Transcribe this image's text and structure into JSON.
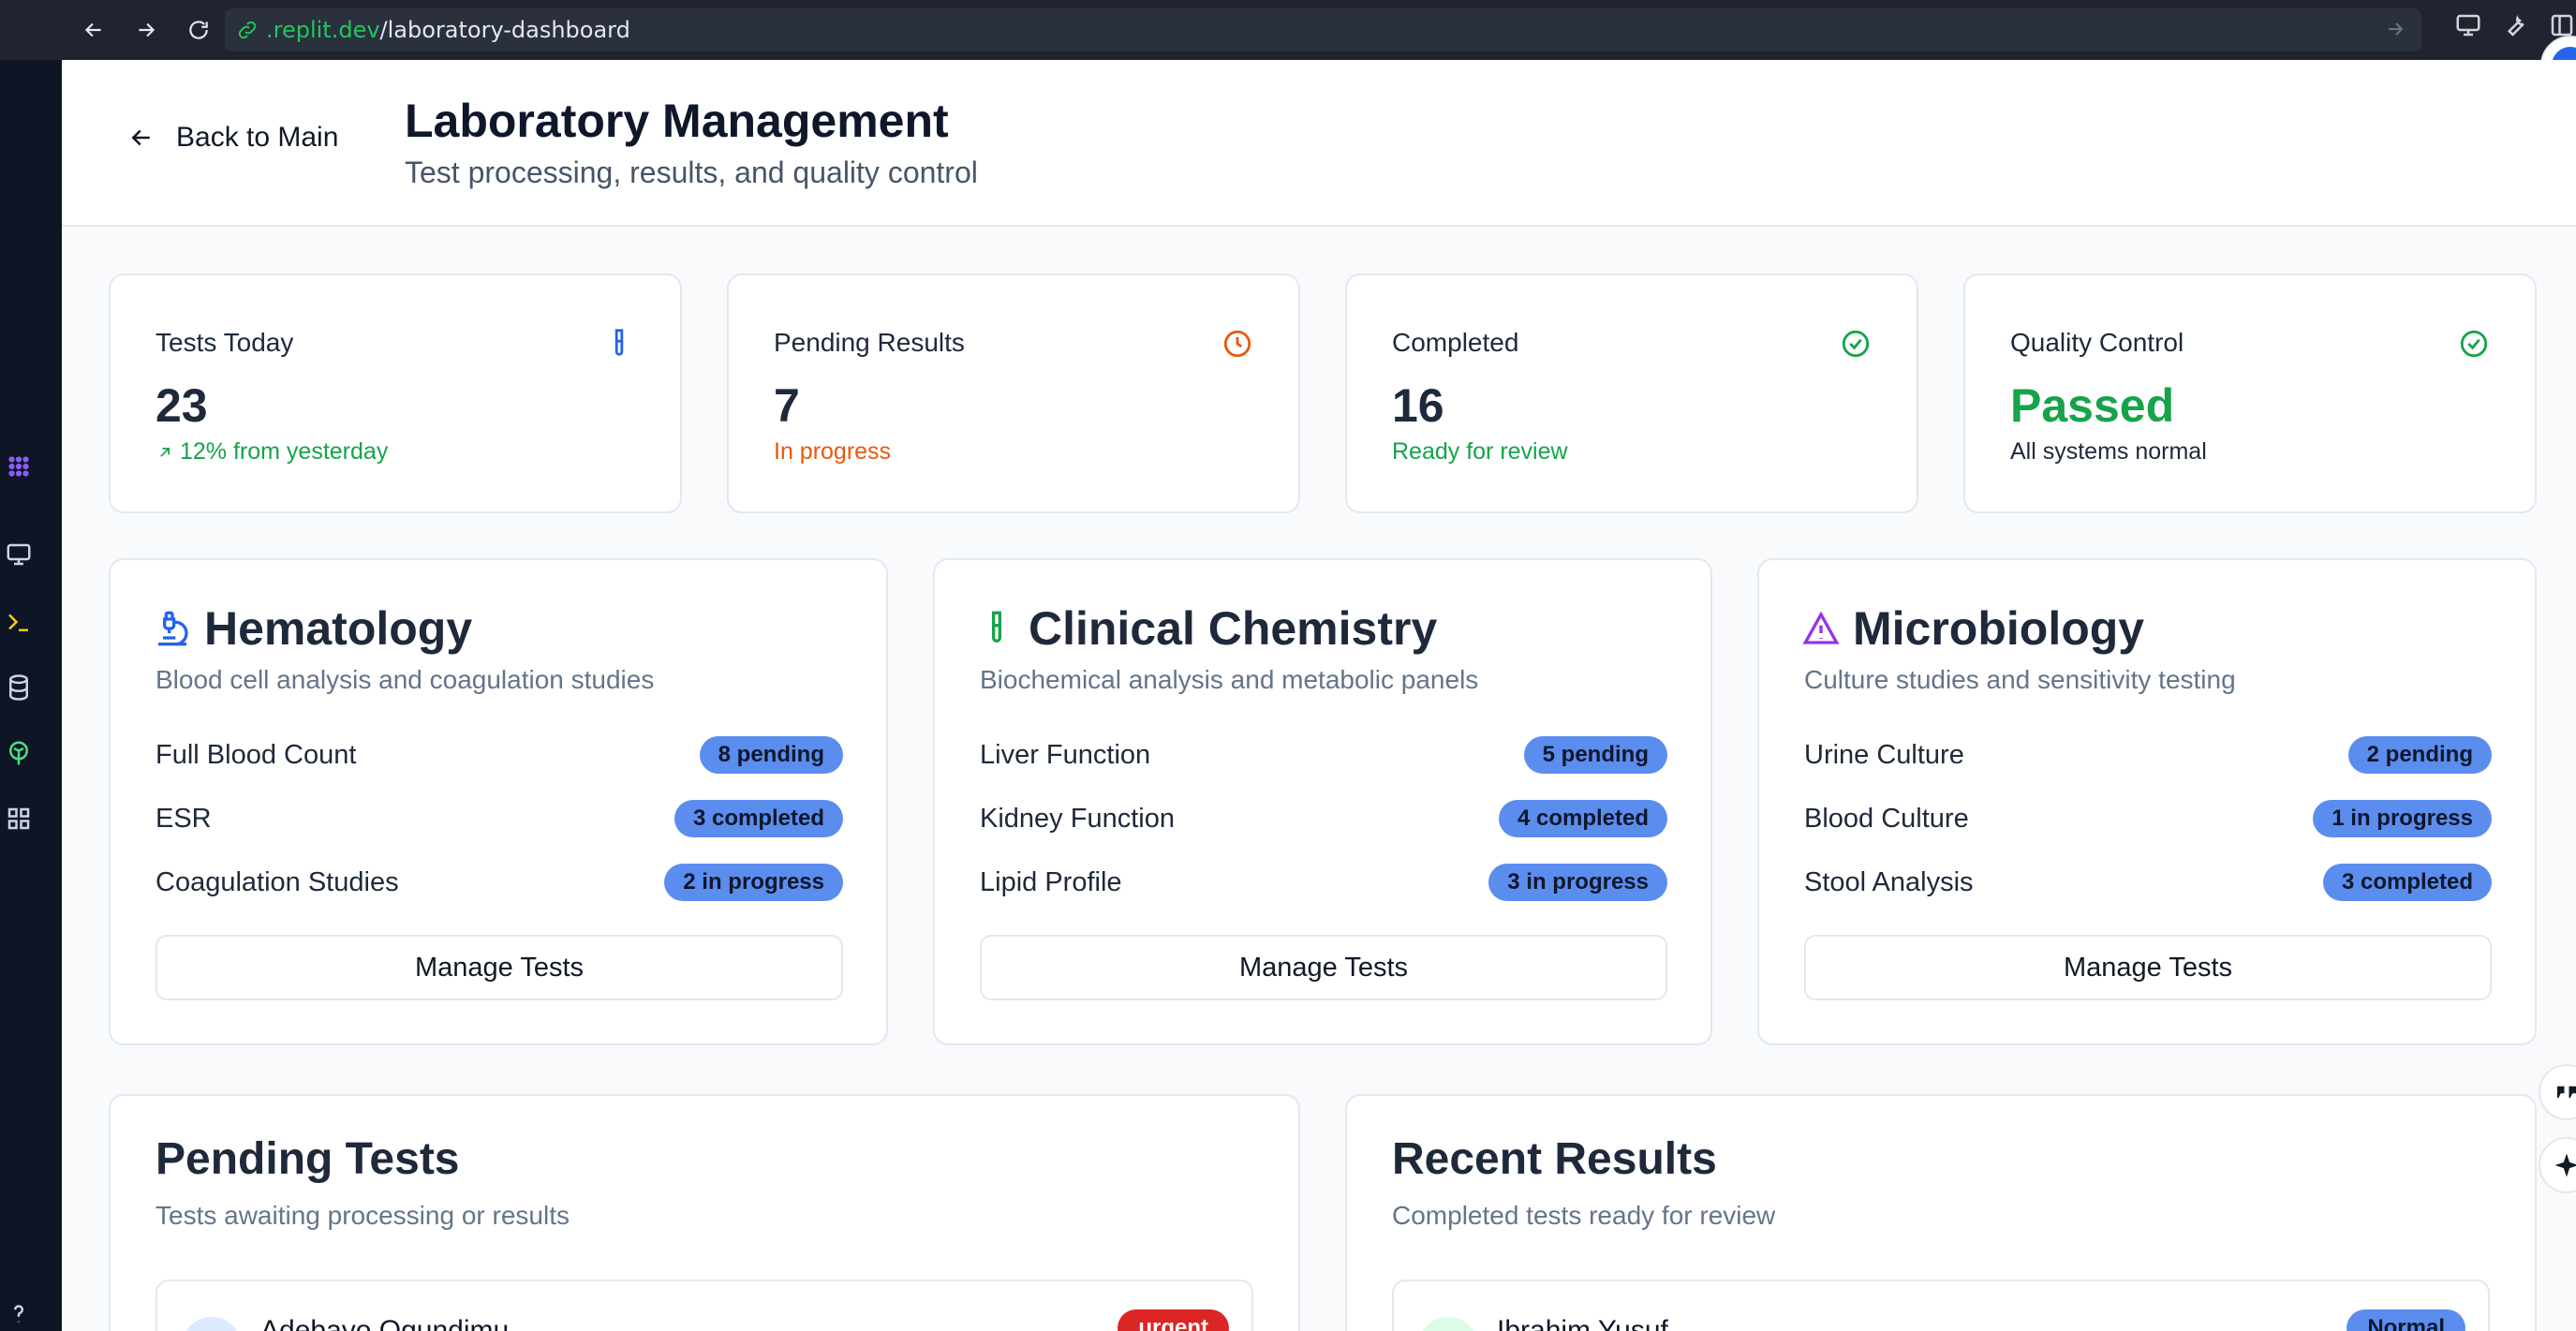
{
  "browser": {
    "url_host": ".replit.dev",
    "url_path": "/laboratory-dashboard"
  },
  "header": {
    "back_label": "Back to Main",
    "title": "Laboratory Management",
    "subtitle": "Test processing, results, and quality control"
  },
  "stats": [
    {
      "label": "Tests Today",
      "value": "23",
      "sub": "12% from yesterday",
      "icon": "test-tube-icon",
      "color": "#16a34a",
      "value_color": "#1e293b"
    },
    {
      "label": "Pending Results",
      "value": "7",
      "sub": "In progress",
      "icon": "clock-icon",
      "color": "#ea580c",
      "value_color": "#1e293b"
    },
    {
      "label": "Completed",
      "value": "16",
      "sub": "Ready for review",
      "icon": "check-circle-icon",
      "color": "#16a34a",
      "value_color": "#1e293b"
    },
    {
      "label": "Quality Control",
      "value": "Passed",
      "sub": "All systems normal",
      "icon": "check-circle-icon",
      "color": "#1e293b",
      "value_color": "#16a34a"
    }
  ],
  "departments": [
    {
      "title": "Hematology",
      "icon": "microscope-icon",
      "description": "Blood cell analysis and coagulation studies",
      "tests": [
        {
          "name": "Full Blood Count",
          "status": "8 pending"
        },
        {
          "name": "ESR",
          "status": "3 completed"
        },
        {
          "name": "Coagulation Studies",
          "status": "2 in progress"
        }
      ],
      "button": "Manage Tests"
    },
    {
      "title": "Clinical Chemistry",
      "icon": "test-tube-icon",
      "description": "Biochemical analysis and metabolic panels",
      "tests": [
        {
          "name": "Liver Function",
          "status": "5 pending"
        },
        {
          "name": "Kidney Function",
          "status": "4 completed"
        },
        {
          "name": "Lipid Profile",
          "status": "3 in progress"
        }
      ],
      "button": "Manage Tests"
    },
    {
      "title": "Microbiology",
      "icon": "warning-triangle-icon",
      "description": "Culture studies and sensitivity testing",
      "tests": [
        {
          "name": "Urine Culture",
          "status": "2 pending"
        },
        {
          "name": "Blood Culture",
          "status": "1 in progress"
        },
        {
          "name": "Stool Analysis",
          "status": "3 completed"
        }
      ],
      "button": "Manage Tests"
    }
  ],
  "pending_tests": {
    "title": "Pending Tests",
    "description": "Tests awaiting processing or results",
    "first_item": {
      "name": "Adebayo Ogundimu",
      "badge": "urgent"
    }
  },
  "recent_results": {
    "title": "Recent Results",
    "description": "Completed tests ready for review",
    "first_item": {
      "name": "Ibrahim Yusuf",
      "badge": "Normal"
    }
  },
  "colors": {
    "accent_blue": "#5b8def",
    "success": "#16a34a",
    "warning": "#ea580c",
    "urgent": "#dc2626"
  }
}
